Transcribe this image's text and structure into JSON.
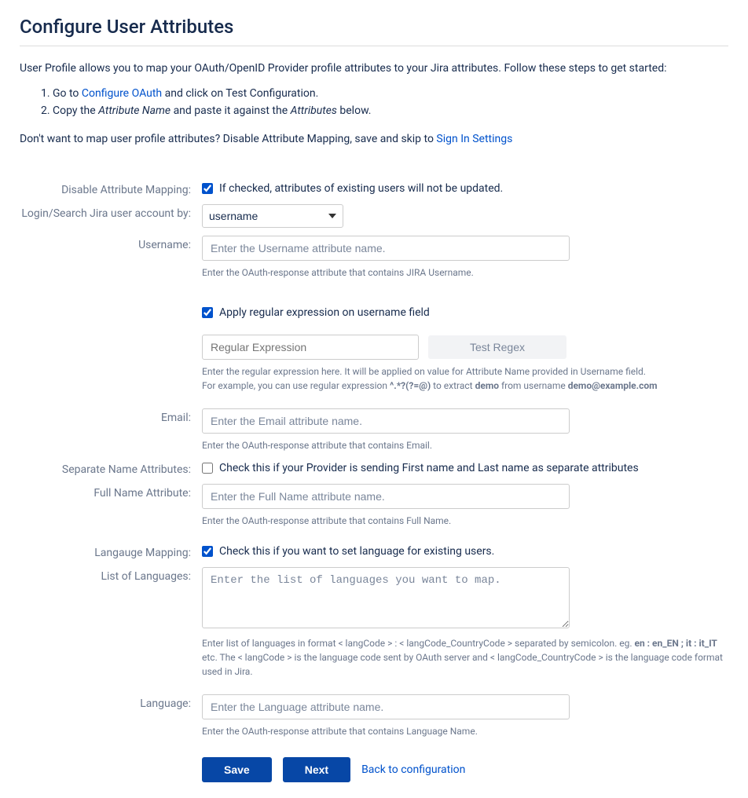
{
  "title": "Configure User Attributes",
  "intro_text": "User Profile allows you to map your OAuth/OpenID Provider profile attributes to your Jira attributes. Follow these steps to get started:",
  "steps": {
    "s1_prefix": "Go to ",
    "s1_link": "Configure OAuth",
    "s1_suffix": " and click on Test Configuration.",
    "s2_prefix": "Copy the ",
    "s2_italic1": "Attribute Name",
    "s2_mid": " and paste it against the ",
    "s2_italic2": "Attributes",
    "s2_suffix": " below."
  },
  "skip_line": {
    "prefix": "Don't want to map user profile attributes? Disable Attribute Mapping, save and skip to ",
    "link": "Sign In Settings"
  },
  "fields": {
    "disable_mapping": {
      "label": "Disable Attribute Mapping:",
      "checked": true,
      "text": "If checked, attributes of existing users will not be updated."
    },
    "login_by": {
      "label": "Login/Search Jira user account by:",
      "selected": "username"
    },
    "username": {
      "label": "Username:",
      "placeholder": "Enter the Username attribute name.",
      "hint": "Enter the OAuth-response attribute that contains JIRA Username."
    },
    "apply_regex": {
      "checked": true,
      "text": "Apply regular expression on username field"
    },
    "regex": {
      "placeholder": "Regular Expression",
      "test_btn": "Test Regex",
      "hint_line1": "Enter the regular expression here. It will be applied on value for Attribute Name provided in Username field.",
      "hint_line2a": "For example, you can use regular expression ",
      "hint_bold1": "^.*?(?=@)",
      "hint_line2b": " to extract ",
      "hint_bold2": "demo",
      "hint_line2c": " from username ",
      "hint_bold3": "demo@example.com"
    },
    "email": {
      "label": "Email:",
      "placeholder": "Enter the Email attribute name.",
      "hint": "Enter the OAuth-response attribute that contains Email."
    },
    "separate_names": {
      "label": "Separate Name Attributes:",
      "checked": false,
      "text": "Check this if your Provider is sending First name and Last name as separate attributes"
    },
    "fullname": {
      "label": "Full Name Attribute:",
      "placeholder": "Enter the Full Name attribute name.",
      "hint": "Enter the OAuth-response attribute that contains Full Name."
    },
    "lang_mapping": {
      "label": "Langauge Mapping:",
      "checked": true,
      "text": "Check this if you want to set language for existing users."
    },
    "lang_list": {
      "label": "List of Languages:",
      "placeholder": "Enter the list of languages you want to map.",
      "hint_a": "Enter list of languages in format < langCode > : < langCode_CountryCode > separated by semicolon. eg. ",
      "hint_bold": "en : en_EN ; it : it_IT",
      "hint_b": " etc. The < langCode > is the language code sent by OAuth server and < langCode_CountryCode > is the language code format used in Jira."
    },
    "language": {
      "label": "Language:",
      "placeholder": "Enter the Language attribute name.",
      "hint": "Enter the OAuth-response attribute that contains Language Name."
    }
  },
  "buttons": {
    "save": "Save",
    "next": "Next",
    "back": "Back to configuration"
  }
}
